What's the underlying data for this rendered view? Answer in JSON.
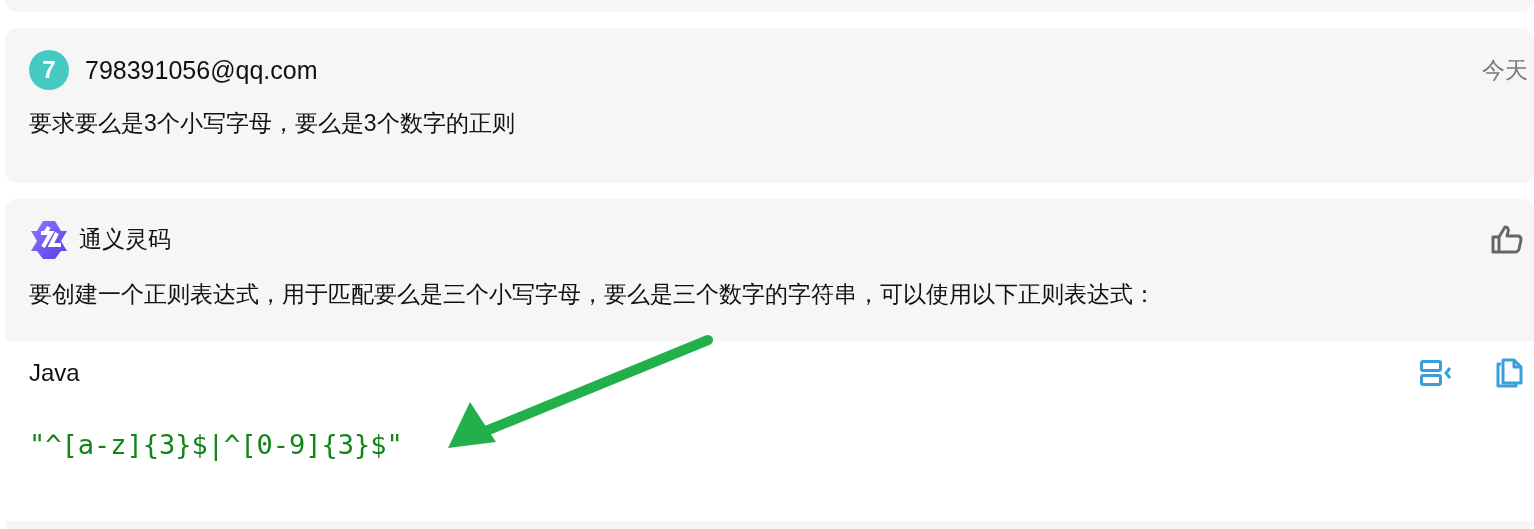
{
  "messages": [
    {
      "kind": "stub"
    },
    {
      "kind": "user",
      "avatar": "7",
      "author": "798391056@qq.com",
      "time": "今天",
      "text": "要求要么是3个小写字母，要么是3个数字的正则"
    },
    {
      "kind": "assistant",
      "author": "通义灵码",
      "text": "要创建一个正则表达式，用于匹配要么是三个小写字母，要么是三个数字的字符串，可以使用以下正则表达式：",
      "code": {
        "language": "Java",
        "text": "\"^[a-z]{3}$|^[0-9]{3}$\""
      }
    },
    {
      "kind": "stub"
    }
  ],
  "annotation": {
    "kind": "arrow",
    "color": "#22b04b"
  }
}
